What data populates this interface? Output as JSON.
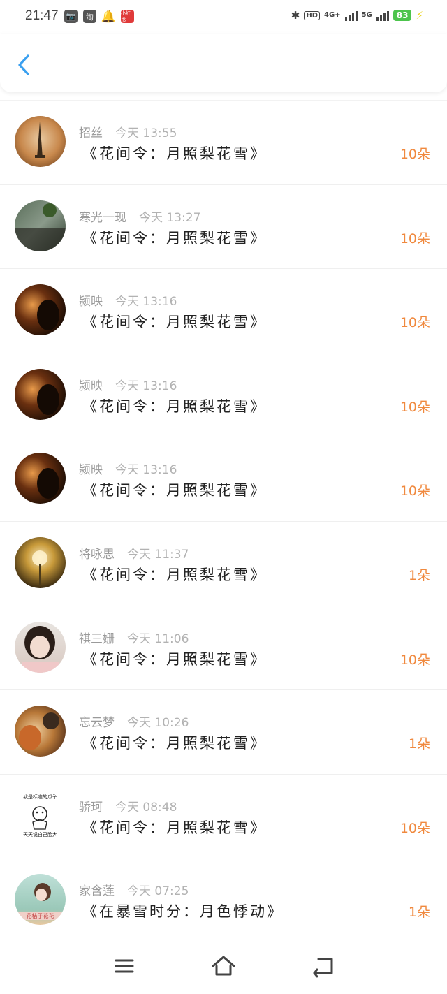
{
  "status_bar": {
    "time": "21:47",
    "app_icons": [
      "📷",
      "淘",
      "🔔",
      "小红书"
    ],
    "network_4g": "4G+",
    "network_5g": "5G",
    "hd": "HD",
    "battery": "83"
  },
  "header": {
    "back_icon": "chevron-left-icon"
  },
  "items": [
    {
      "name": "招丝",
      "time": "今天 13:55",
      "title": "《花间令：月照梨花雪》",
      "amount": "10朵",
      "avatar": "a1"
    },
    {
      "name": "寒光一现",
      "time": "今天 13:27",
      "title": "《花间令：月照梨花雪》",
      "amount": "10朵",
      "avatar": "a2"
    },
    {
      "name": "颍映",
      "time": "今天 13:16",
      "title": "《花间令：月照梨花雪》",
      "amount": "10朵",
      "avatar": "a3"
    },
    {
      "name": "颍映",
      "time": "今天 13:16",
      "title": "《花间令：月照梨花雪》",
      "amount": "10朵",
      "avatar": "a3"
    },
    {
      "name": "颍映",
      "time": "今天 13:16",
      "title": "《花间令：月照梨花雪》",
      "amount": "10朵",
      "avatar": "a3"
    },
    {
      "name": "将咏思",
      "time": "今天 11:37",
      "title": "《花间令：月照梨花雪》",
      "amount": "1朵",
      "avatar": "a4"
    },
    {
      "name": "祺三姗",
      "time": "今天 11:06",
      "title": "《花间令：月照梨花雪》",
      "amount": "10朵",
      "avatar": "a5"
    },
    {
      "name": "忘云梦",
      "time": "今天 10:26",
      "title": "《花间令：月照梨花雪》",
      "amount": "1朵",
      "avatar": "a6"
    },
    {
      "name": "骄珂",
      "time": "今天 08:48",
      "title": "《花间令：月照梨花雪》",
      "amount": "10朵",
      "avatar": "a7",
      "avatar_text_top": "我是标准的瓜子",
      "avatar_text_bottom": "天天说自己脸大"
    },
    {
      "name": "家含莲",
      "time": "今天 07:25",
      "title": "《在暴雪时分：月色悸动》",
      "amount": "1朵",
      "avatar": "a8",
      "avatar_text_bottom": "花桔子花花"
    }
  ],
  "nav_bar": {
    "menu_icon": "menu-icon",
    "home_icon": "home-icon",
    "back_icon": "back-icon"
  }
}
